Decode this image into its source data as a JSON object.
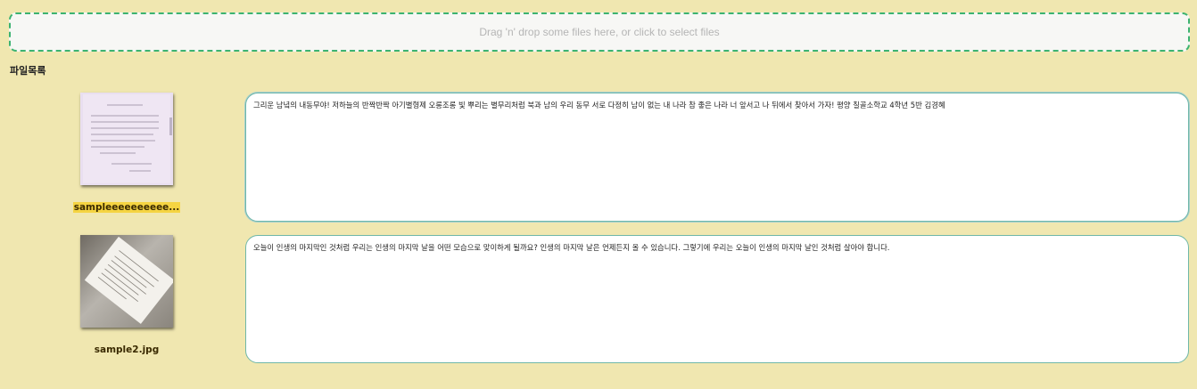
{
  "dropzone": {
    "text": "Drag 'n' drop some files here, or click to select files"
  },
  "file_list": {
    "title": "파일목록",
    "items": [
      {
        "filename": "sampleeeeeeeeee...",
        "thumbnail_icon": "handwritten-poem-thumbnail",
        "text": "그리운 남녘의 내동무야! 저하늘의 반짝반짝 아기별형제 오롱조롱 빛 뿌리는 별무리처럼 북과 남의 우리 동무 서로 다정히 남이 없는 내 나라 참 좋은 나라 너 앞서고 나 뒤에서 찾아서 가자! 평양 칠골소학교 4학년 5반 김경혜"
      },
      {
        "filename": "sample2.jpg",
        "thumbnail_icon": "book-page-photo-thumbnail",
        "text": "오늘이 인생의 마지막인 것처럼 우리는 인생의 마지막 날을 어떤 모습으로 맞이하게 될까요? 인생의 마지막 날은 언제든지 올 수 있습니다. 그렇기에 우리는 오늘이 인생의 마지막 날인 것처럼 살아야 합니다."
      }
    ]
  },
  "colors": {
    "background": "#f0e7b0",
    "dropzone_border": "#3cb371",
    "filename_highlight": "#f5d442",
    "textarea_border": "#6fb7a8"
  }
}
